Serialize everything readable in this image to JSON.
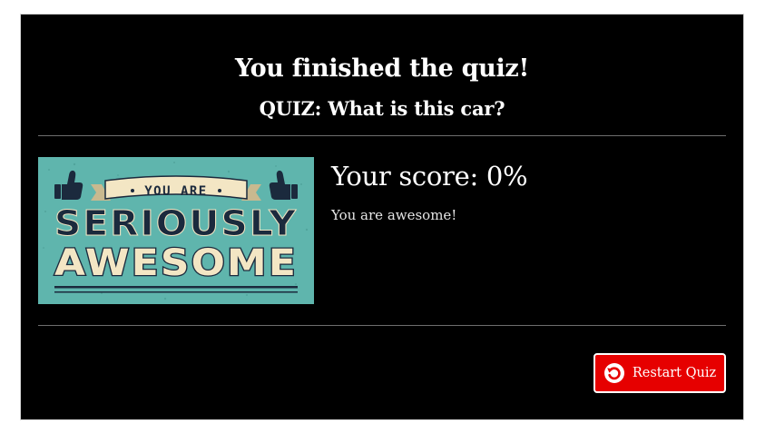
{
  "quiz": {
    "finished_title": "You finished the quiz!",
    "quiz_name": "QUIZ: What is this car?"
  },
  "result": {
    "score_label": "Your score: 0%",
    "message": "You are awesome!",
    "image": {
      "line1": "YOU ARE",
      "line2": "SERIOUSLY",
      "line3": "AWESOME"
    }
  },
  "actions": {
    "restart_label": "Restart Quiz",
    "restart_icon": "restart-icon"
  },
  "colors": {
    "panel_background": "#000000",
    "button_background": "#e60000",
    "image_background": "#5fb5ad",
    "image_ink": "#1b2a3d",
    "image_banner": "#f3e6c4"
  }
}
